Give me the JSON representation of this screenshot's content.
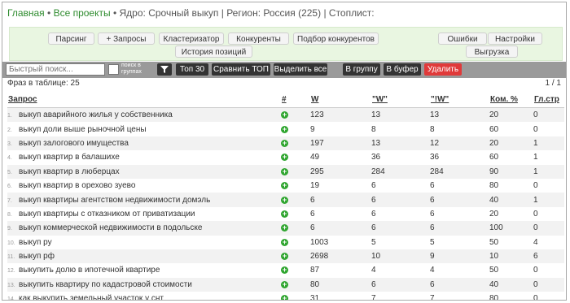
{
  "breadcrumb": {
    "home": "Главная",
    "projects": "Все проекты",
    "core": "Ядро: Срочный выкуп",
    "region": "Регион: Россия (225)",
    "stoplist": "Стоплист:"
  },
  "toolbar": {
    "parsing": "Парсинг",
    "add_queries": "+ Запросы",
    "clusterizer": "Кластеризатор",
    "competitors": "Конкуренты",
    "competitor_selection": "Подбор конкурентов",
    "position_history": "История позиций",
    "errors": "Ошибки",
    "settings": "Настройки",
    "export": "Выгрузка"
  },
  "filter": {
    "search_placeholder": "Быстрый поиск...",
    "group_search_label": "поиск в группах",
    "filter_icon": "funnel-icon",
    "top30": "Топ 30",
    "compare_top": "Сравнить ТОП",
    "select_all": "Выделить все",
    "to_group": "В группу",
    "to_buffer": "В буфер",
    "delete": "Удалить",
    "delete_color": "#e03a3a"
  },
  "table": {
    "phrase_count": "Фраз в таблице: 25",
    "pager": "1 / 1",
    "columns": [
      "Запрос",
      "#",
      "W",
      "\"W\"",
      "\"!W\"",
      "Ком. %",
      "Гл.стр"
    ],
    "rows": [
      {
        "n": "1.",
        "q": "выкуп аварийного жилья у собственника",
        "w": "123",
        "qw": "13",
        "ew": "13",
        "com": "20",
        "gl": "0"
      },
      {
        "n": "2.",
        "q": "выкуп доли выше рыночной цены",
        "w": "9",
        "qw": "8",
        "ew": "8",
        "com": "60",
        "gl": "0"
      },
      {
        "n": "3.",
        "q": "выкуп залогового имущества",
        "w": "197",
        "qw": "13",
        "ew": "12",
        "com": "20",
        "gl": "1"
      },
      {
        "n": "4.",
        "q": "выкуп квартир в балашихе",
        "w": "49",
        "qw": "36",
        "ew": "36",
        "com": "60",
        "gl": "1"
      },
      {
        "n": "5.",
        "q": "выкуп квартир в люберцах",
        "w": "295",
        "qw": "284",
        "ew": "284",
        "com": "90",
        "gl": "1"
      },
      {
        "n": "6.",
        "q": "выкуп квартир в орехово зуево",
        "w": "19",
        "qw": "6",
        "ew": "6",
        "com": "80",
        "gl": "0"
      },
      {
        "n": "7.",
        "q": "выкуп квартиры агентством недвижимости домэль",
        "w": "6",
        "qw": "6",
        "ew": "6",
        "com": "40",
        "gl": "1"
      },
      {
        "n": "8.",
        "q": "выкуп квартиры с отказником от приватизации",
        "w": "6",
        "qw": "6",
        "ew": "6",
        "com": "20",
        "gl": "0"
      },
      {
        "n": "9.",
        "q": "выкуп коммерческой недвижимости в подольске",
        "w": "6",
        "qw": "6",
        "ew": "6",
        "com": "100",
        "gl": "0"
      },
      {
        "n": "10.",
        "q": "выкуп ру",
        "w": "1003",
        "qw": "5",
        "ew": "5",
        "com": "50",
        "gl": "4"
      },
      {
        "n": "11.",
        "q": "выкуп рф",
        "w": "2698",
        "qw": "10",
        "ew": "9",
        "com": "10",
        "gl": "6"
      },
      {
        "n": "12.",
        "q": "выкупить долю в ипотечной квартире",
        "w": "87",
        "qw": "4",
        "ew": "4",
        "com": "50",
        "gl": "0"
      },
      {
        "n": "13.",
        "q": "выкупить квартиру по кадастровой стоимости",
        "w": "80",
        "qw": "6",
        "ew": "6",
        "com": "40",
        "gl": "0"
      },
      {
        "n": "14.",
        "q": "как выкупить земельный участок у снт",
        "w": "31",
        "qw": "7",
        "ew": "7",
        "com": "80",
        "gl": "0"
      }
    ]
  }
}
